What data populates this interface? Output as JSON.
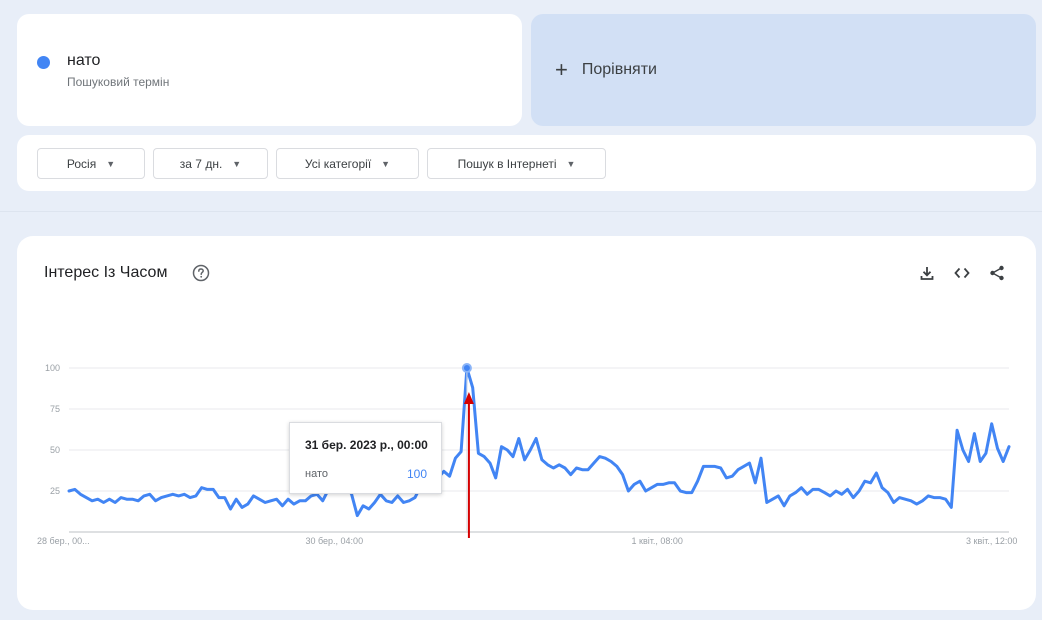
{
  "term": {
    "name": "нато",
    "subtitle": "Пошуковий термін",
    "color": "#4285f4"
  },
  "compare": {
    "plus": "+",
    "label": "Порівняти"
  },
  "filters": [
    {
      "label": "Росія"
    },
    {
      "label": "за 7 дн."
    },
    {
      "label": "Усі категорії"
    },
    {
      "label": "Пошук в Інтернеті"
    }
  ],
  "chart": {
    "title": "Інтерес Із Часом",
    "icons": [
      "help-icon",
      "download-icon",
      "embed-icon",
      "share-icon"
    ],
    "tooltip": {
      "date": "31 бер. 2023 р., 00:00",
      "term": "нато",
      "value": "100"
    },
    "annotation_color": "#d50000"
  },
  "chart_data": {
    "type": "line",
    "y_ticks": [
      "100",
      "75",
      "50",
      "25"
    ],
    "x_ticks": [
      "28 бер., 00...",
      "30 бер., 04:00",
      "1 квіт., 08:00",
      "3 квіт., 12:00"
    ],
    "ylim": [
      0,
      100
    ],
    "series": [
      {
        "name": "нато",
        "color": "#4285f4",
        "values": [
          25,
          26,
          23,
          21,
          19,
          20,
          18,
          20,
          18,
          21,
          20,
          20,
          19,
          22,
          23,
          19,
          21,
          22,
          23,
          22,
          23,
          21,
          22,
          27,
          26,
          26,
          21,
          21,
          14,
          20,
          15,
          17,
          22,
          20,
          18,
          19,
          20,
          16,
          20,
          17,
          19,
          19,
          22,
          23,
          19,
          26,
          27,
          27,
          29,
          23,
          10,
          16,
          14,
          18,
          23,
          19,
          18,
          22,
          18,
          19,
          21,
          28,
          30,
          31,
          33,
          37,
          34,
          45,
          49,
          100,
          88,
          48,
          46,
          42,
          33,
          52,
          50,
          46,
          57,
          44,
          50,
          57,
          44,
          41,
          39,
          41,
          39,
          35,
          39,
          38,
          38,
          42,
          46,
          45,
          43,
          40,
          35,
          25,
          29,
          31,
          25,
          27,
          29,
          29,
          30,
          30,
          25,
          24,
          24,
          31,
          40,
          40,
          40,
          39,
          33,
          34,
          38,
          40,
          42,
          30,
          45,
          18,
          20,
          22,
          16,
          22,
          24,
          27,
          23,
          26,
          26,
          24,
          22,
          25,
          23,
          26,
          21,
          25,
          31,
          30,
          36,
          27,
          24,
          18,
          21,
          20,
          19,
          17,
          19,
          22,
          21,
          21,
          20,
          15,
          62,
          50,
          43,
          60,
          43,
          48,
          66,
          51,
          43,
          52
        ]
      }
    ]
  }
}
